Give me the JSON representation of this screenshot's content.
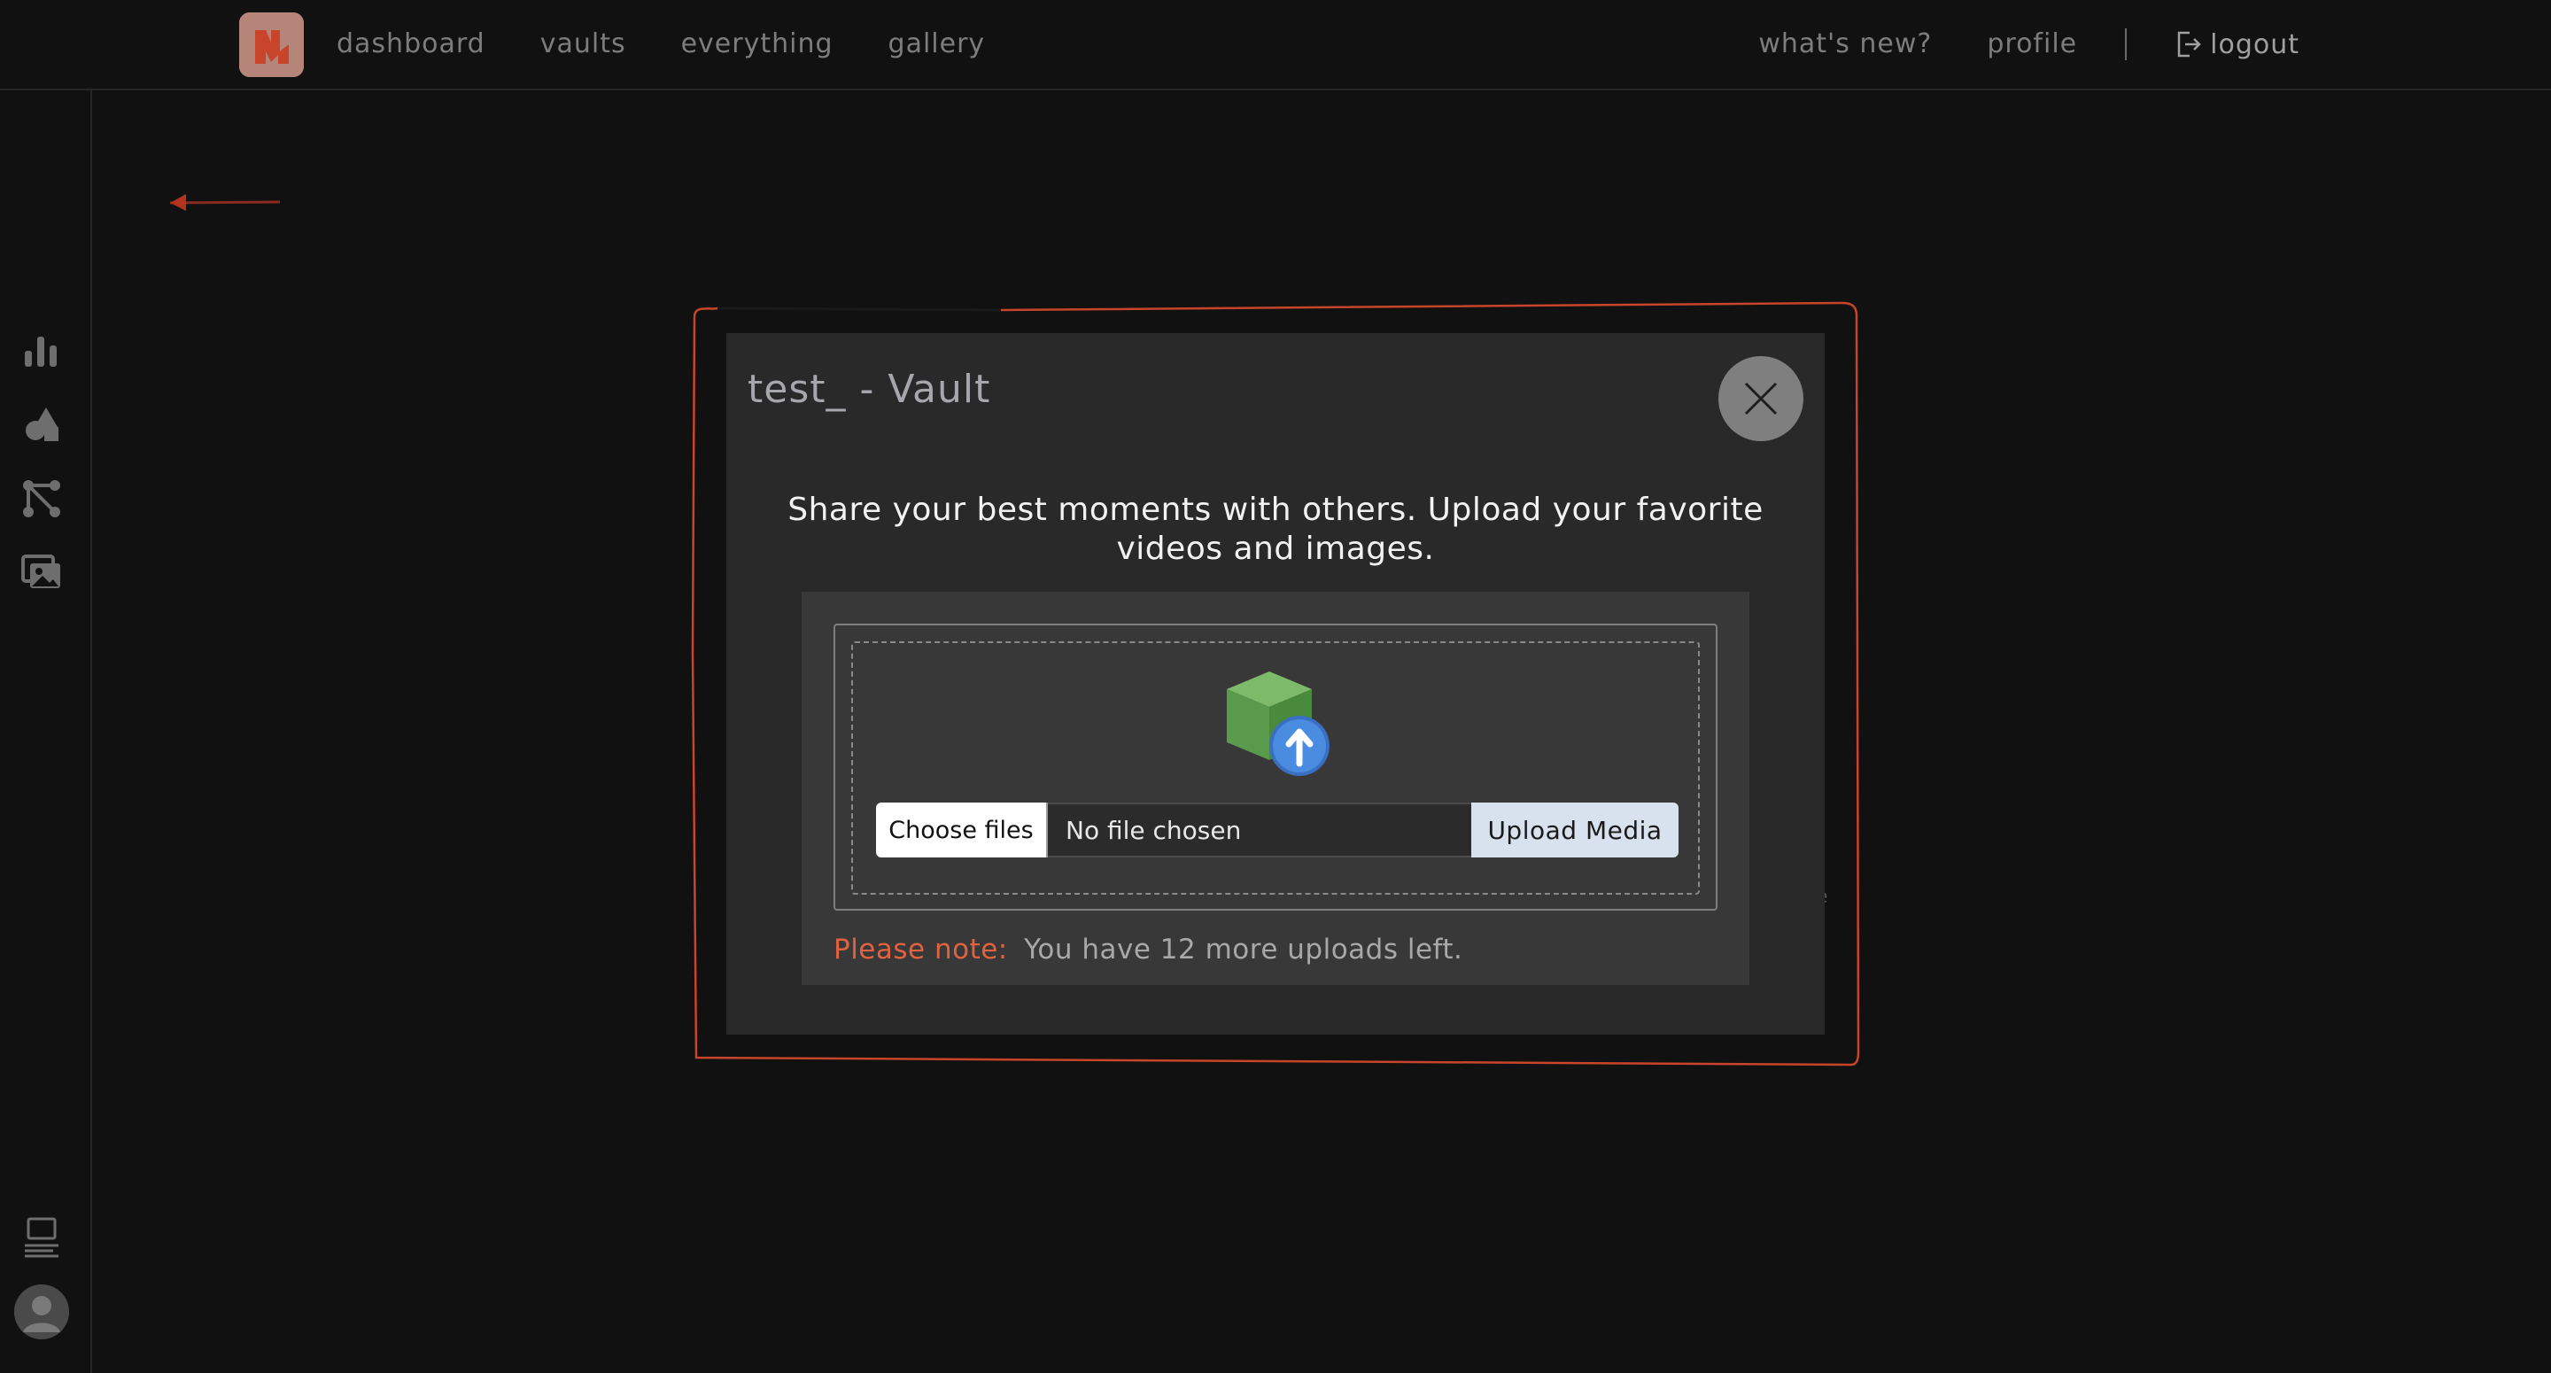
{
  "nav": {
    "left_links": [
      "dashboard",
      "vaults",
      "everything",
      "gallery"
    ],
    "whats_new": "what's new?",
    "profile": "profile",
    "separator": "|",
    "logout": "logout"
  },
  "modal": {
    "title": "test_ - Vault",
    "description": "Share your best moments with others. Upload your favorite videos and images.",
    "choose_files_label": "Choose files",
    "file_status": "No file chosen",
    "upload_button_label": "Upload Media",
    "note_label": "Please note:",
    "note_text": "You have 12 more uploads left."
  },
  "colors": {
    "background": "#111111",
    "modal": "#292929",
    "panel": "#383838",
    "accent": "#e0623e",
    "logo": "#b5857a",
    "upload_button": "#d8e2ee"
  },
  "icons": {
    "logo": "brand-logo",
    "logout": "logout-icon",
    "sidebar": [
      "bar-chart-icon",
      "shapes-icon",
      "graph-nodes-icon",
      "images-icon",
      "list-icon"
    ],
    "close": "close-icon",
    "upload": "box-upload-icon",
    "back": "back-arrow-icon",
    "avatar": "user-avatar"
  }
}
